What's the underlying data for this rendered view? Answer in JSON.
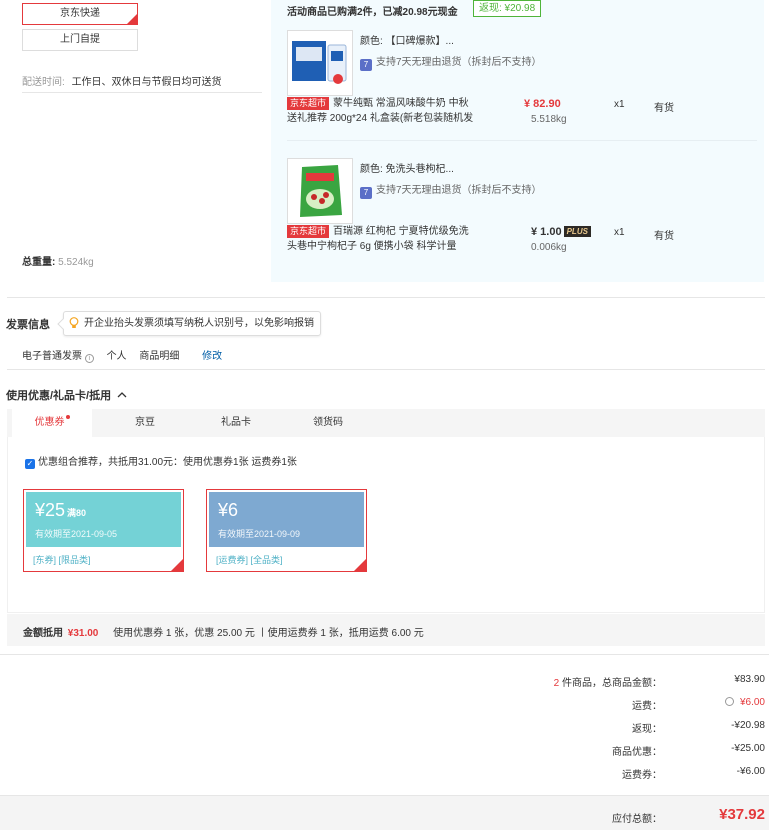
{
  "delivery": {
    "options": [
      "京东快递",
      "上门自提"
    ],
    "time_label": "配送时间:",
    "time_value": "工作日、双休日与节假日均可送货",
    "total_weight_label": "总重量:",
    "total_weight_value": "5.524kg"
  },
  "promo": {
    "text": "活动商品已购满2件，已减20.98元现金",
    "badge": "返现: ¥20.98"
  },
  "goods": [
    {
      "attr": "颜色: 【口碑爆款】...",
      "support": "支持7天无理由退货（拆封后不支持）",
      "support_icon": "7",
      "tag": "京东超市",
      "name": "蒙牛纯甄 常温风味酸牛奶 中秋送礼推荐 200g*24 礼盒装(新老包装随机发",
      "price": "¥ 82.90",
      "weight": "5.518kg",
      "qty": "x1",
      "stock": "有货"
    },
    {
      "attr": "颜色: 免洗头巷枸杞...",
      "support": "支持7天无理由退货（拆封后不支持）",
      "support_icon": "7",
      "tag": "京东超市",
      "name": "百瑞源 红枸杞 宁夏特优级免洗头巷中宁枸杞子 6g 便携小袋 科学计量",
      "price": "¥ 1.00",
      "plus": "PLUS",
      "weight": "0.006kg",
      "qty": "x1",
      "stock": "有货"
    }
  ],
  "invoice": {
    "title": "发票信息",
    "tip": "开企业抬头发票须填写纳税人识别号，以免影响报销",
    "type": "电子普通发票",
    "person": "个人",
    "detail": "商品明细",
    "edit": "修改"
  },
  "discount": {
    "title": "使用优惠/礼品卡/抵用",
    "tabs": [
      "优惠券",
      "京豆",
      "礼品卡",
      "领货码"
    ],
    "combo_text": "优惠组合推荐，共抵用31.00元：使用优惠券1张 运费券1张",
    "coupons": [
      {
        "amount": "¥25",
        "cond": "满80",
        "expire": "有效期至2021-09-05",
        "tags": "[东券]  [限品类]",
        "color": "#74d2d6"
      },
      {
        "amount": "¥6",
        "cond": "",
        "expire": "有效期至2021-09-09",
        "tags": "[运费券]  [全品类]",
        "color": "#7ea9d1"
      }
    ],
    "summary_label": "金额抵用",
    "summary_amount": "¥31.00",
    "summary_detail": "使用优惠券 1 张，优惠 25.00 元 丨使用运费券 1 张，抵用运费 6.00 元"
  },
  "totals": {
    "count": "2",
    "count_suffix": " 件商品，总商品金额：",
    "goods_amount": "¥83.90",
    "freight_label": "运费：",
    "freight_value": "¥6.00",
    "cashback_label": "返现：",
    "cashback_value": "-¥20.98",
    "goods_discount_label": "商品优惠：",
    "goods_discount_value": "-¥25.00",
    "freight_coupon_label": "运费券：",
    "freight_coupon_value": "-¥6.00",
    "payable_label": "应付总额：",
    "payable_value": "¥37.92"
  },
  "colors": {
    "accent": "#e4393c",
    "link": "#005ea7",
    "green": "#4fb43a"
  }
}
